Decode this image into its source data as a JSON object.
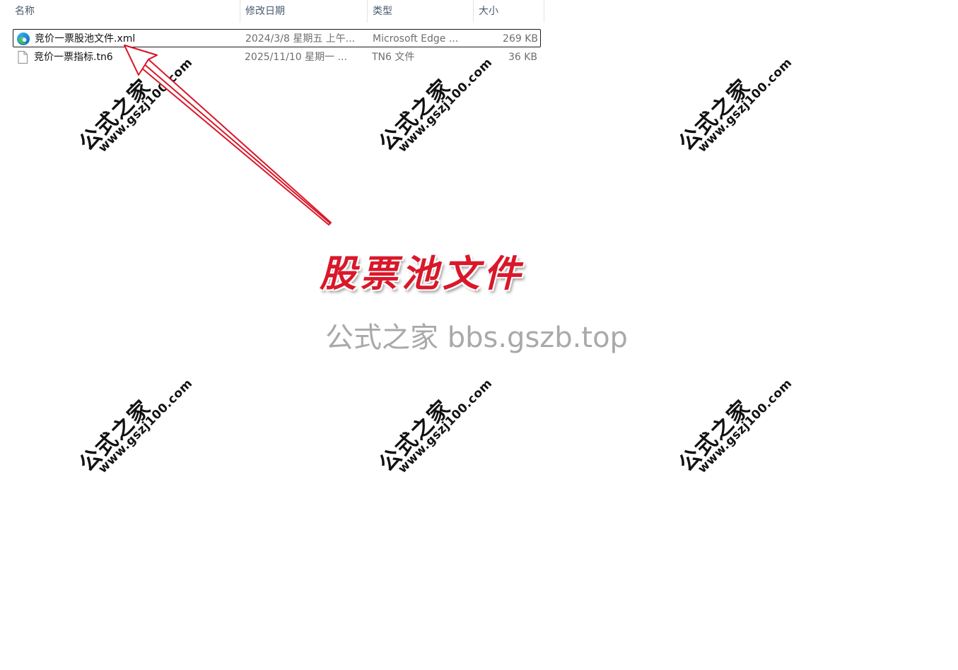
{
  "columns": {
    "name": "名称",
    "date": "修改日期",
    "type": "类型",
    "size": "大小"
  },
  "files": [
    {
      "icon": "edge-icon",
      "name": "竞价一票股池文件.xml",
      "date": "2024/3/8 星期五 上午...",
      "type": "Microsoft Edge ...",
      "size": "269 KB",
      "selected": true
    },
    {
      "icon": "file-icon",
      "name": "竞价一票指标.tn6",
      "date": "2025/11/10 星期一 ...",
      "type": "TN6 文件",
      "size": "36 KB",
      "selected": false
    }
  ],
  "watermark": {
    "cn": "公式之家",
    "url": "www.gszj100.com"
  },
  "annotation": "股票池文件",
  "site_watermark": "公式之家 bbs.gszb.top",
  "colors": {
    "annotation": "#d9182a",
    "arrow": "#d9182a",
    "header_text": "#4a5a6e",
    "secondary_text": "#6e6e6e"
  }
}
